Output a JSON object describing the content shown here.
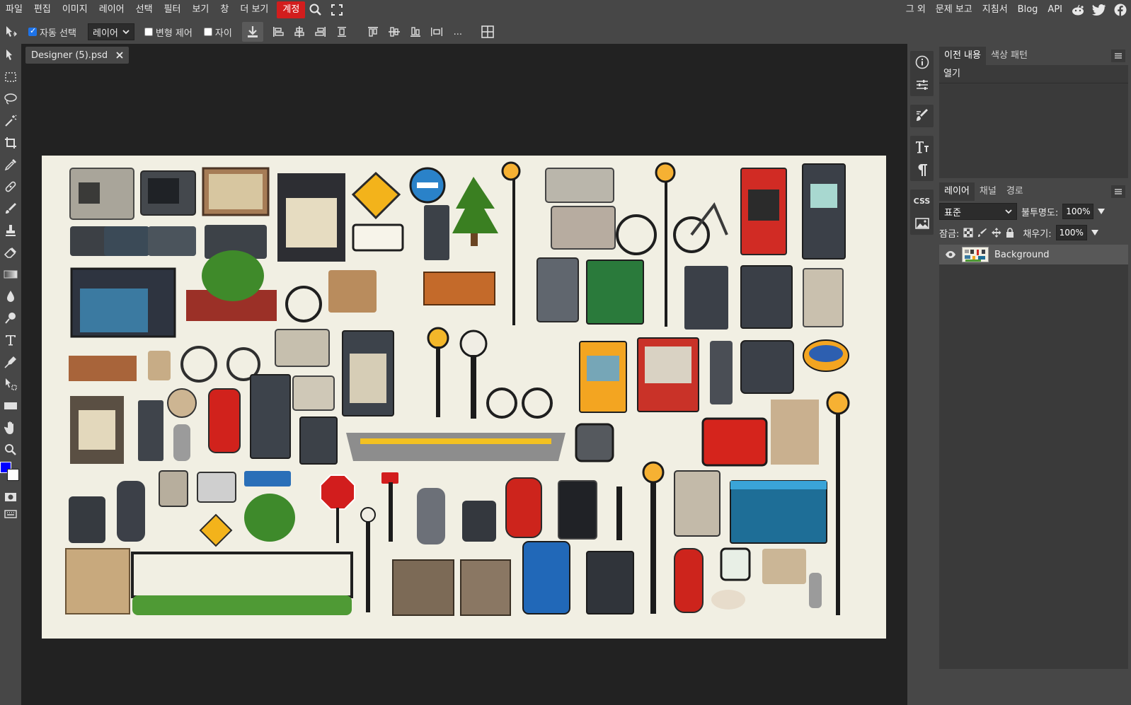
{
  "menu": {
    "items": [
      "파일",
      "편집",
      "이미지",
      "레이어",
      "선택",
      "필터",
      "보기",
      "창",
      "더 보기"
    ],
    "account": "계정",
    "right": [
      "그 외",
      "문제 보고",
      "지침서",
      "Blog",
      "API"
    ]
  },
  "options": {
    "auto_select_label": "자동 선택",
    "auto_select_checked": true,
    "target_value": "레이어",
    "transform_label": "변형 제어",
    "transform_checked": false,
    "distance_label": "자이",
    "distance_checked": false,
    "more_label": "..."
  },
  "document": {
    "tab_title": "Designer (5).psd"
  },
  "colors": {
    "foreground": "#0000ff",
    "background": "#ffffff",
    "accent": "#d21d1d"
  },
  "history_panel": {
    "tabs": [
      "이전 내용",
      "색상 패턴"
    ],
    "entries": [
      "열기"
    ]
  },
  "layers_panel": {
    "tabs": [
      "레이어",
      "채널",
      "경로"
    ],
    "blend_mode": "표준",
    "opacity_label": "불투명도:",
    "opacity": "100%",
    "lock_label": "잠금:",
    "fill_label": "채우기:",
    "fill": "100%",
    "layers": [
      {
        "name": "Background",
        "visible": true
      }
    ]
  },
  "sidecol": {
    "css_label": "CSS"
  }
}
